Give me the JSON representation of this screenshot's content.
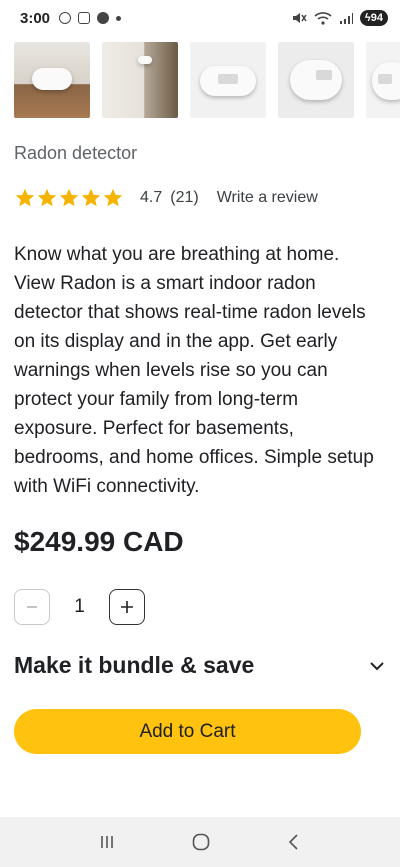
{
  "status_bar": {
    "time": "3:00",
    "battery": "94"
  },
  "gallery": {
    "thumbnails": [
      "thumbnail-1",
      "thumbnail-2",
      "thumbnail-3",
      "thumbnail-4",
      "thumbnail-5"
    ]
  },
  "product": {
    "type": "Radon detector",
    "rating_value": "4.7",
    "rating_count": "(21)",
    "rating_stars": 4.7,
    "write_review_label": "Write a review",
    "description": "Know what you are breathing at home. View Radon is a smart indoor radon detector that shows real-time radon levels on its display and in the app. Get early warnings when levels rise so you can protect your family from long-term exposure. Perfect for basements, bedrooms, and home offices. Simple setup with WiFi connectivity.",
    "price": "$249.99 CAD"
  },
  "quantity": {
    "value": "1",
    "decrement_icon": "minus-icon",
    "increment_icon": "plus-icon"
  },
  "bundle": {
    "title": "Make it bundle & save",
    "icon": "chevron-down-icon"
  },
  "cart": {
    "add_label": "Add to Cart"
  },
  "colors": {
    "accent": "#ffc20e",
    "star": "#f5b400"
  },
  "nav_bar": {
    "icons": [
      "recent-apps-icon",
      "home-icon",
      "back-icon"
    ]
  }
}
